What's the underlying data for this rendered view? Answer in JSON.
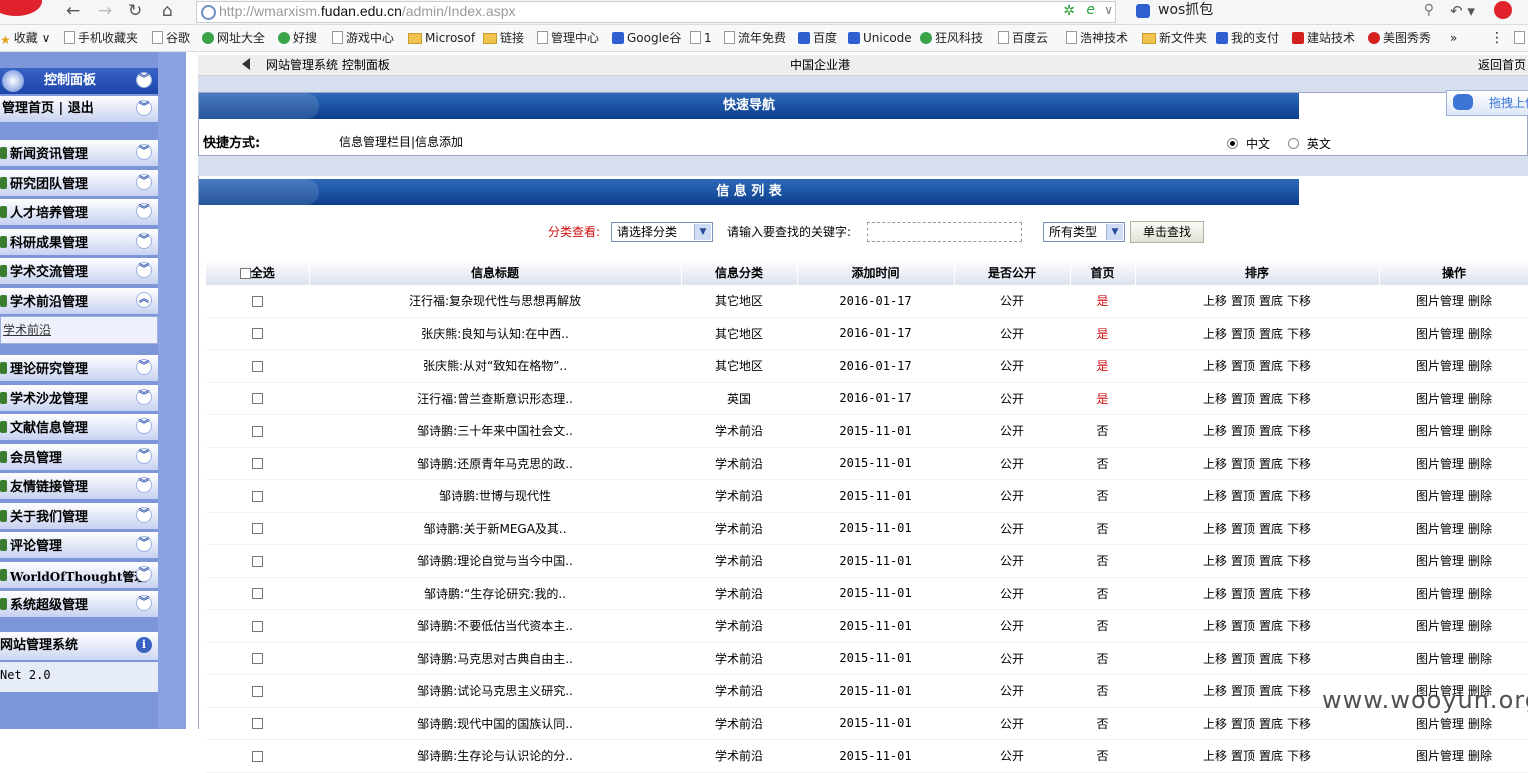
{
  "browser": {
    "url_prefix": "http://wmarxism.",
    "url_domain": "fudan.edu.cn",
    "url_suffix": "/admin/Index.aspx",
    "search_text": "wos抓包",
    "bookmarks": [
      "收藏",
      "手机收藏夹",
      "谷歌",
      "网址大全",
      "好搜",
      "游戏中心",
      "Microsof",
      "链接",
      "管理中心",
      "Google谷",
      "1",
      "流年免费",
      "百度",
      "Unicode",
      "狂风科技",
      "百度云",
      "浩神技术",
      "新文件夹",
      "我的支付",
      "建站技术",
      "美图秀秀",
      "»"
    ]
  },
  "sidebar": {
    "panel_title": "控制面板",
    "home_links": "管理首页 | 退出",
    "menu": [
      "新闻资讯管理",
      "研究团队管理",
      "人才培养管理",
      "科研成果管理",
      "学术交流管理",
      "学术前沿管理"
    ],
    "sub_item": "学术前沿",
    "menu2": [
      "理论研究管理",
      "学术沙龙管理",
      "文献信息管理",
      "会员管理",
      "友情链接管理",
      "关于我们管理",
      "评论管理",
      "WorldOfThought管理",
      "系统超级管理"
    ],
    "system_title": "网站管理系统",
    "version": "Net 2.0"
  },
  "crumb": {
    "path": "网站管理系统 控制面板",
    "center": "中国企业港",
    "right": "返回首页"
  },
  "quicknav": {
    "title": "快速导航",
    "label": "快捷方式:",
    "links": "信息管理栏目|信息添加",
    "lang_cn": "中文",
    "lang_en": "英文",
    "upload_label": "拖拽上传"
  },
  "infolist": {
    "title": "信 息 列 表",
    "filter_label": "分类查看:",
    "category_select": "请选择分类",
    "keyword_label": "请输入要查找的关键字:",
    "type_select": "所有类型",
    "search_button": "单击查找",
    "columns": [
      "全选",
      "信息标题",
      "信息分类",
      "添加时间",
      "是否公开",
      "首页",
      "排序",
      "操作"
    ],
    "sort_actions": [
      "上移",
      "置顶",
      "置底",
      "下移"
    ],
    "ops": [
      "图片管理",
      "删除"
    ],
    "rows": [
      {
        "title": "汪行福:复杂现代性与思想再解放",
        "cat": "其它地区",
        "date": "2016-01-17",
        "public": "公开",
        "home": "是"
      },
      {
        "title": "张庆熊:良知与认知:在中西..",
        "cat": "其它地区",
        "date": "2016-01-17",
        "public": "公开",
        "home": "是"
      },
      {
        "title": "张庆熊:从对“致知在格物”..",
        "cat": "其它地区",
        "date": "2016-01-17",
        "public": "公开",
        "home": "是"
      },
      {
        "title": "汪行福:曾兰查斯意识形态理..",
        "cat": "英国",
        "date": "2016-01-17",
        "public": "公开",
        "home": "是"
      },
      {
        "title": "邹诗鹏:三十年来中国社会文..",
        "cat": "学术前沿",
        "date": "2015-11-01",
        "public": "公开",
        "home": "否"
      },
      {
        "title": "邹诗鹏:还原青年马克思的政..",
        "cat": "学术前沿",
        "date": "2015-11-01",
        "public": "公开",
        "home": "否"
      },
      {
        "title": "邹诗鹏:世博与现代性",
        "cat": "学术前沿",
        "date": "2015-11-01",
        "public": "公开",
        "home": "否"
      },
      {
        "title": "邹诗鹏:关于新MEGA及其..",
        "cat": "学术前沿",
        "date": "2015-11-01",
        "public": "公开",
        "home": "否"
      },
      {
        "title": "邹诗鹏:理论自觉与当今中国..",
        "cat": "学术前沿",
        "date": "2015-11-01",
        "public": "公开",
        "home": "否"
      },
      {
        "title": "邹诗鹏:“生存论研究:我的..",
        "cat": "学术前沿",
        "date": "2015-11-01",
        "public": "公开",
        "home": "否"
      },
      {
        "title": "邹诗鹏:不要低估当代资本主..",
        "cat": "学术前沿",
        "date": "2015-11-01",
        "public": "公开",
        "home": "否"
      },
      {
        "title": "邹诗鹏:马克思对古典自由主..",
        "cat": "学术前沿",
        "date": "2015-11-01",
        "public": "公开",
        "home": "否"
      },
      {
        "title": "邹诗鹏:试论马克思主义研究..",
        "cat": "学术前沿",
        "date": "2015-11-01",
        "public": "公开",
        "home": "否"
      },
      {
        "title": "邹诗鹏:现代中国的国族认同..",
        "cat": "学术前沿",
        "date": "2015-11-01",
        "public": "公开",
        "home": "否"
      },
      {
        "title": "邹诗鹏:生存论与认识论的分..",
        "cat": "学术前沿",
        "date": "2015-11-01",
        "public": "公开",
        "home": "否"
      }
    ]
  },
  "watermark": "www.wooyun.org"
}
